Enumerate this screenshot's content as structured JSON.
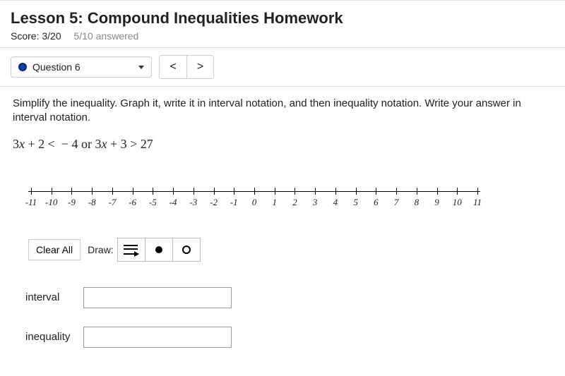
{
  "header": {
    "title": "Lesson 5: Compound Inequalities Homework",
    "score_label": "Score: 3/20",
    "answered_label": "5/10 answered"
  },
  "toolbar": {
    "question_label": "Question 6",
    "prev_glyph": "<",
    "next_glyph": ">"
  },
  "problem": {
    "instructions": "Simplify the inequality. Graph it, write it in interval notation, and then inequality notation. Write your answer in interval notation.",
    "math_text": "3x + 2 <  − 4 or 3x + 3 > 27"
  },
  "numberline": {
    "min": -11,
    "max": 11,
    "labels": [
      "-11",
      "-10",
      "-9",
      "-8",
      "-7",
      "-6",
      "-5",
      "-4",
      "-3",
      "-2",
      "-1",
      "0",
      "1",
      "2",
      "3",
      "4",
      "5",
      "6",
      "7",
      "8",
      "9",
      "10",
      "11"
    ]
  },
  "tools": {
    "clear_label": "Clear All",
    "draw_label": "Draw:"
  },
  "fields": {
    "interval_label": "interval",
    "interval_value": "",
    "inequality_label": "inequality",
    "inequality_value": ""
  }
}
